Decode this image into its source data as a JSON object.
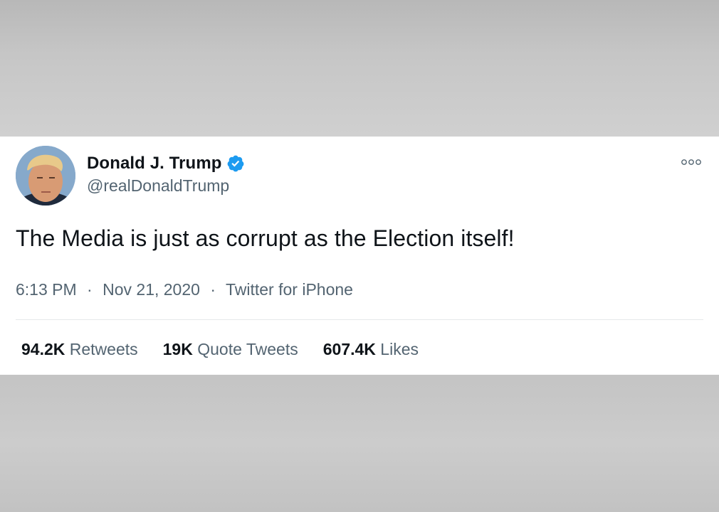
{
  "colors": {
    "verified_blue": "#1d9bf0",
    "text_primary": "#0f1419",
    "text_secondary": "#536471"
  },
  "tweet": {
    "author": {
      "display_name": "Donald J. Trump",
      "handle": "@realDonaldTrump",
      "verified_icon": "verified-badge-icon",
      "avatar_icon": "avatar"
    },
    "more_icon": "more-options-icon",
    "text": "The Media is just as corrupt as the Election itself!",
    "meta": {
      "time": "6:13 PM",
      "separator": "·",
      "date": "Nov 21, 2020",
      "source": "Twitter for iPhone"
    },
    "stats": [
      {
        "count": "94.2K",
        "label": "Retweets"
      },
      {
        "count": "19K",
        "label": "Quote Tweets"
      },
      {
        "count": "607.4K",
        "label": "Likes"
      }
    ]
  }
}
